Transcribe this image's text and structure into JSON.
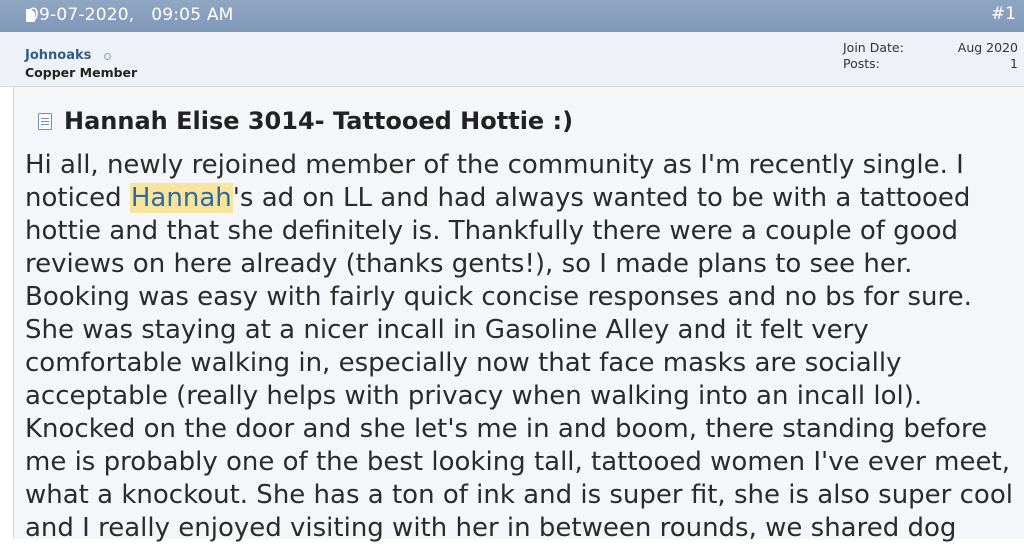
{
  "header": {
    "date": "09-07-2020,",
    "time": "09:05 AM",
    "post_number": "#1"
  },
  "user": {
    "name": "Johnoaks",
    "title": "Copper Member",
    "join_label": "Join Date:",
    "join_value": "Aug 2020",
    "posts_label": "Posts:",
    "posts_value": "1"
  },
  "post": {
    "title": "Hannah Elise 3014- Tattooed Hottie :)",
    "highlight": "Hannah",
    "lines": [
      "Hi all, newly rejoined member of the community as I'm recently single. I",
      "noticed ",
      "'s ad on LL and had always wanted to be with a tattooed",
      "hottie and that she definitely is. Thankfully there were a couple of good",
      "reviews on here already (thanks gents!), so I made plans to see her.",
      "Booking was easy with fairly quick concise responses and no bs for sure.",
      "She was staying at a nicer incall in Gasoline Alley and it felt very",
      "comfortable walking in, especially now that face masks are socially",
      "acceptable (really helps with privacy when walking into an incall lol).",
      "Knocked on the door and she let's me in and boom, there standing before",
      "me is probably one of the best looking tall, tattooed women I've ever meet,",
      "what a knockout. She has a ton of ink and is super fit, she is also super cool",
      "and I really enjoyed visiting with her in between rounds, we shared dog"
    ]
  }
}
